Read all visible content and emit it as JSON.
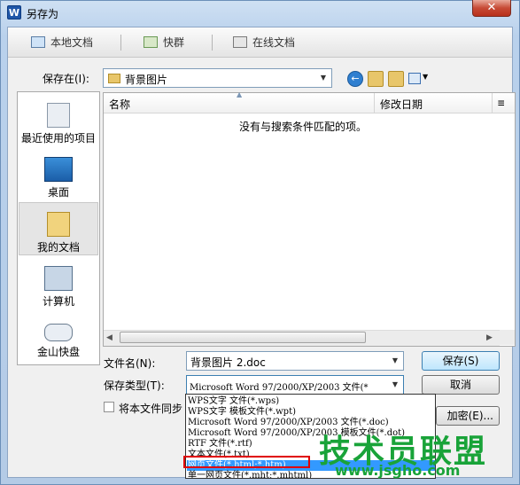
{
  "window": {
    "title": "另存为",
    "close_glyph": "✕",
    "app_icon_letter": "W"
  },
  "tabs": [
    {
      "label": "本地文档",
      "icon": "computer-icon"
    },
    {
      "label": "快群",
      "icon": "group-icon"
    },
    {
      "label": "在线文档",
      "icon": "cloud-doc-icon"
    }
  ],
  "save_in": {
    "label": "保存在(I):",
    "value": "背景图片"
  },
  "places": [
    {
      "label": "最近使用的项目",
      "icon": "recent-icon"
    },
    {
      "label": "桌面",
      "icon": "desktop-icon"
    },
    {
      "label": "我的文档",
      "icon": "documents-icon",
      "selected": true
    },
    {
      "label": "计算机",
      "icon": "computer-icon"
    },
    {
      "label": "金山快盘",
      "icon": "kuaipan-icon"
    }
  ],
  "file_list": {
    "columns": [
      "名称",
      "修改日期",
      "[column-cut-off]"
    ],
    "empty_message": "没有与搜索条件匹配的项。"
  },
  "filename": {
    "label": "文件名(N):",
    "value": "背景图片 2.doc"
  },
  "filetype": {
    "label": "保存类型(T):",
    "value": "Microsoft Word 97/2000/XP/2003 文件(*"
  },
  "sync_checkbox": {
    "label": "将本文件同步",
    "checked": false
  },
  "buttons": {
    "save": "保存(S)",
    "cancel": "取消",
    "encrypt": "加密(E)..."
  },
  "filetype_options": [
    "WPS文字 文件(*.wps)",
    "WPS文字 模板文件(*.wpt)",
    "Microsoft Word 97/2000/XP/2003 文件(*.doc)",
    "Microsoft Word 97/2000/XP/2003 模板文件(*.dot)",
    "RTF 文件(*.rtf)",
    "文本文件(*.txt)",
    "网页文件(*.html;*.htm)",
    "单一网页文件(*.mht;*.mhtml)"
  ],
  "highlighted_option_index": 6,
  "watermark": {
    "brand": "技术员联盟",
    "url": "www.jsgho.com"
  },
  "colors": {
    "accent": "#3399ff",
    "highlight_border": "#e00000",
    "watermark": "#19a339"
  }
}
